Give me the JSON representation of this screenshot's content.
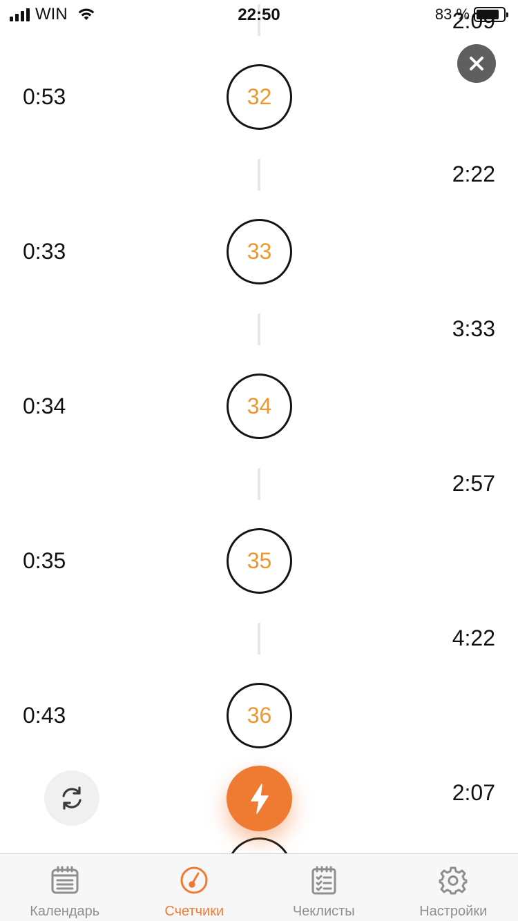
{
  "status_bar": {
    "carrier": "WIN",
    "time": "22:50",
    "battery": "83 %"
  },
  "timeline": {
    "top_right_time": "2:09",
    "rows": [
      {
        "number": "32",
        "left_time": "0:53",
        "right_time": "2:22"
      },
      {
        "number": "33",
        "left_time": "0:33",
        "right_time": "3:33"
      },
      {
        "number": "34",
        "left_time": "0:34",
        "right_time": "2:57"
      },
      {
        "number": "35",
        "left_time": "0:35",
        "right_time": "4:22"
      },
      {
        "number": "36",
        "left_time": "0:43",
        "right_time": "2:07"
      }
    ]
  },
  "actions": {
    "close_icon": "close-icon",
    "refresh_icon": "refresh-icon",
    "bolt_icon": "lightning-icon"
  },
  "tabbar": {
    "tabs": [
      {
        "label": "Календарь",
        "icon": "calendar-icon",
        "active": false
      },
      {
        "label": "Счетчики",
        "icon": "gauge-icon",
        "active": true
      },
      {
        "label": "Чеклисты",
        "icon": "checklist-icon",
        "active": false
      },
      {
        "label": "Настройки",
        "icon": "gear-icon",
        "active": false
      }
    ]
  },
  "colors": {
    "accent": "#ef7b33",
    "number": "#f0962e"
  }
}
